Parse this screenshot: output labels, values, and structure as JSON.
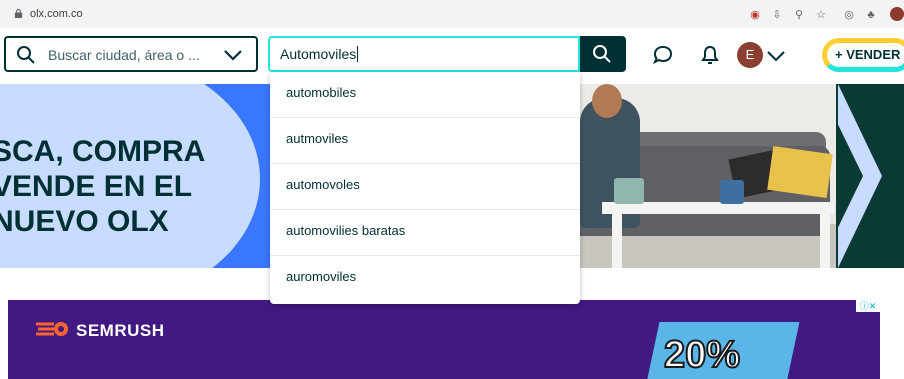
{
  "browser": {
    "url": "olx.com.co"
  },
  "header": {
    "location_placeholder": "Buscar ciudad, área o ...",
    "search_value": "Automoviles",
    "avatar_letter": "E",
    "sell_label": "+ VENDER"
  },
  "suggestions": [
    "automobiles",
    "autmoviles",
    "automovoles",
    "automovilies baratas",
    "auromoviles"
  ],
  "hero": {
    "line1": "SCA, COMPRA",
    "line2": "VENDE EN EL",
    "line3": "NUEVO OLX"
  },
  "ad": {
    "brand": "SEMRUSH",
    "percent_text": "20%"
  },
  "colors": {
    "brand_dark": "#002f34",
    "accent_teal": "#23e5db",
    "hero_blue": "#3a77ff",
    "ad_purple": "#421983"
  }
}
